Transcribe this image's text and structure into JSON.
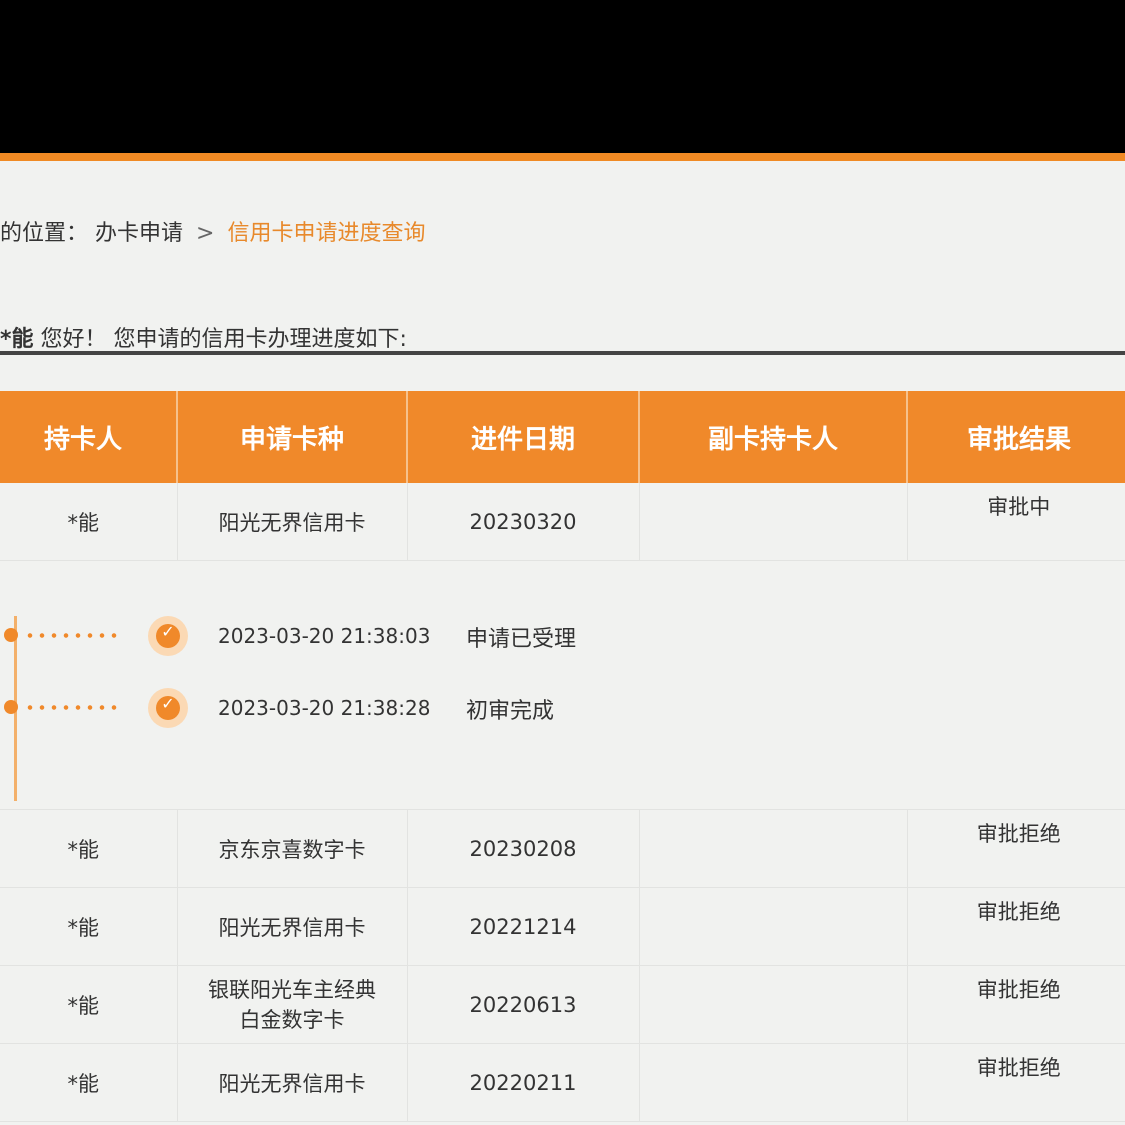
{
  "breadcrumb": {
    "prefix": "的位置：",
    "parent": "办卡申请",
    "separator": ">",
    "current": "信用卡申请进度查询"
  },
  "greeting": {
    "lead": "",
    "name": "*能",
    "text": "您好！ 您申请的信用卡办理进度如下:"
  },
  "table": {
    "headers": [
      "持卡人",
      "申请卡种",
      "进件日期",
      "副卡持卡人",
      "审批结果"
    ],
    "first_row": {
      "holder": "*能",
      "card_type": "阳光无界信用卡",
      "date": "20230320",
      "secondary": "",
      "result": "审批中"
    },
    "timeline": [
      {
        "time": "2023-03-20 21:38:03",
        "status": "申请已受理"
      },
      {
        "time": "2023-03-20 21:38:28",
        "status": "初审完成"
      }
    ],
    "rows": [
      {
        "holder": "*能",
        "card_type": "京东京喜数字卡",
        "date": "20230208",
        "secondary": "",
        "result": "审批拒绝"
      },
      {
        "holder": "*能",
        "card_type": "阳光无界信用卡",
        "date": "20221214",
        "secondary": "",
        "result": "审批拒绝"
      },
      {
        "holder": "*能",
        "card_type": "银联阳光车主经典白金数字卡",
        "date": "20220613",
        "secondary": "",
        "result": "审批拒绝"
      },
      {
        "holder": "*能",
        "card_type": "阳光无界信用卡",
        "date": "20220211",
        "secondary": "",
        "result": "审批拒绝"
      }
    ]
  },
  "colors": {
    "accent": "#f0892a",
    "reject": "#e0302a"
  }
}
